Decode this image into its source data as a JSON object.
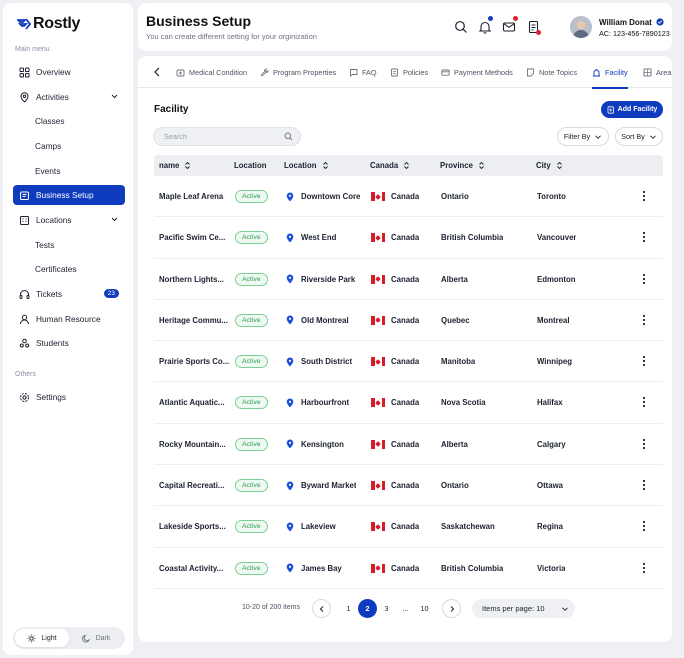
{
  "app": {
    "name": "Rostly"
  },
  "sidebar": {
    "main_label": "Main menu",
    "others_label": "Others",
    "items": [
      {
        "label": "Overview"
      },
      {
        "label": "Activities"
      },
      {
        "label": "Classes"
      },
      {
        "label": "Camps"
      },
      {
        "label": "Events"
      },
      {
        "label": "Business Setup"
      },
      {
        "label": "Locations"
      },
      {
        "label": "Tests"
      },
      {
        "label": "Certificates"
      },
      {
        "label": "Tickets",
        "badge": "23"
      },
      {
        "label": "Human Resource"
      },
      {
        "label": "Students"
      },
      {
        "label": "Settings"
      }
    ],
    "theme": {
      "light": "Light",
      "dark": "Dark"
    }
  },
  "header": {
    "title": "Business Setup",
    "subtitle": "You can create different setting for your orginization",
    "user": {
      "name": "William Donat",
      "account": "AC: 123-456-7890123"
    }
  },
  "tabs": [
    {
      "label": "Medical Condition"
    },
    {
      "label": "Program Properties"
    },
    {
      "label": "FAQ"
    },
    {
      "label": "Policies"
    },
    {
      "label": "Payment Methods"
    },
    {
      "label": "Note Topics"
    },
    {
      "label": "Facility"
    },
    {
      "label": "Area"
    }
  ],
  "facility": {
    "title": "Facility",
    "add_label": "Add Facility",
    "search_placeholder": "Search",
    "filter_label": "Filter By",
    "sort_label": "Sort By",
    "columns": [
      "name",
      "Location",
      "Location",
      "Canada",
      "Province",
      "City"
    ],
    "rows": [
      {
        "name": "Maple Leaf Arena",
        "status": "Active",
        "location": "Downtown Core",
        "country": "Canada",
        "province": "Ontario",
        "city": "Toronto"
      },
      {
        "name": "Pacific Swim Ce...",
        "status": "Active",
        "location": "West End",
        "country": "Canada",
        "province": "British Columbia",
        "city": "Vancouver"
      },
      {
        "name": "Northern Lights...",
        "status": "Active",
        "location": "Riverside Park",
        "country": "Canada",
        "province": "Alberta",
        "city": "Edmonton"
      },
      {
        "name": "Heritage Commu...",
        "status": "Active",
        "location": "Old Montreal",
        "country": "Canada",
        "province": "Quebec",
        "city": "Montreal"
      },
      {
        "name": "Prairie Sports Co...",
        "status": "Active",
        "location": "South District",
        "country": "Canada",
        "province": "Manitoba",
        "city": "Winnipeg"
      },
      {
        "name": "Atlantic Aquatic...",
        "status": "Active",
        "location": "Harbourfront",
        "country": "Canada",
        "province": "Nova Scotia",
        "city": "Halifax"
      },
      {
        "name": "Rocky Mountain...",
        "status": "Active",
        "location": "Kensington",
        "country": "Canada",
        "province": "Alberta",
        "city": "Calgary"
      },
      {
        "name": "Capital Recreati...",
        "status": "Active",
        "location": "Byward Market",
        "country": "Canada",
        "province": "Ontario",
        "city": "Ottawa"
      },
      {
        "name": "Lakeside Sports...",
        "status": "Active",
        "location": "Lakeview",
        "country": "Canada",
        "province": "Saskatchewan",
        "city": "Regina"
      },
      {
        "name": "Coastal Activity...",
        "status": "Active",
        "location": "James Bay",
        "country": "Canada",
        "province": "British Columbia",
        "city": "Victoria"
      }
    ]
  },
  "pagination": {
    "count": "10-20 of 200 items",
    "pages": [
      "1",
      "2",
      "3",
      "...",
      "10"
    ],
    "current": "2",
    "per_page": "Items per page: 10"
  },
  "colors": {
    "accent": "#0f3bbf",
    "active_green": "#2f9a52",
    "notify_red": "#e0202f"
  }
}
